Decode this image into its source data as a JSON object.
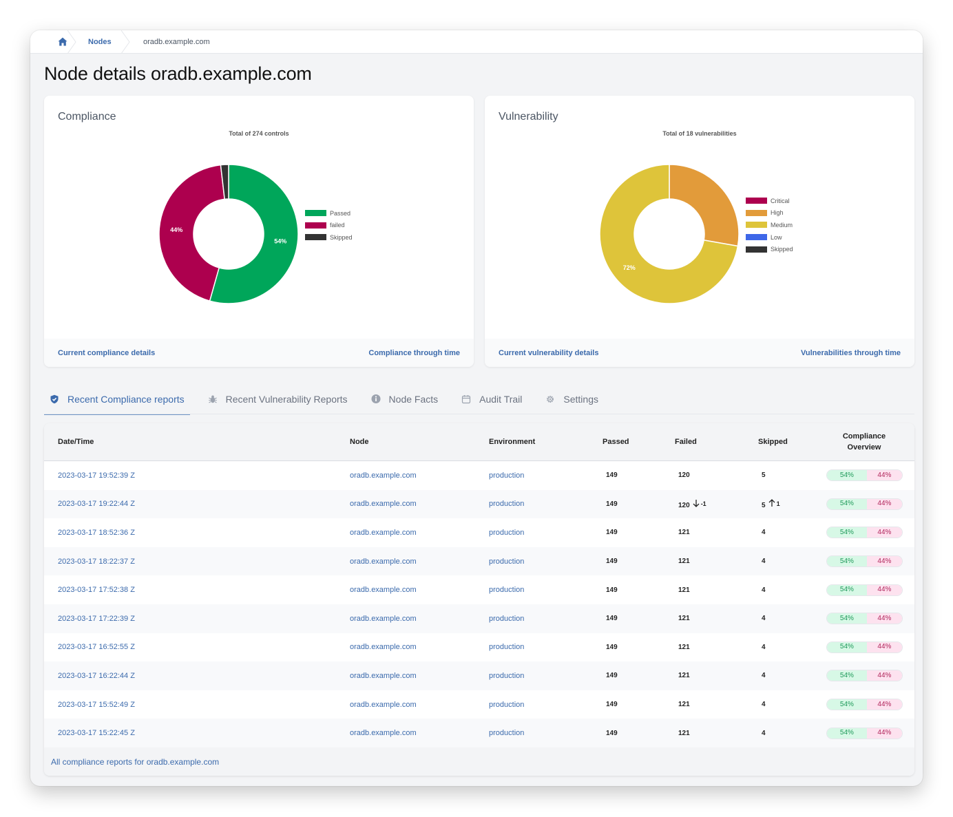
{
  "breadcrumb": {
    "home_icon": "home-icon",
    "items": [
      "Nodes",
      "oradb.example.com"
    ]
  },
  "page": {
    "title": "Node details oradb.example.com"
  },
  "colors": {
    "accent": "#3b6aac",
    "passed": "#00a65a",
    "failed": "#ad004e",
    "skipped": "#333333",
    "critical": "#ad004e",
    "high": "#e29b3a",
    "medium": "#dec43a",
    "low": "#3e67e8"
  },
  "compliance_card": {
    "title": "Compliance",
    "footer_left": "Current compliance details",
    "footer_right": "Compliance through time"
  },
  "vulnerability_card": {
    "title": "Vulnerability",
    "footer_left": "Current vulnerability details",
    "footer_right": "Vulnerabilities through time"
  },
  "chart_data": [
    {
      "type": "pie",
      "variant": "donut",
      "title": "Total of 274 controls",
      "categories": [
        "Passed",
        "failed",
        "Skipped"
      ],
      "values": [
        149,
        120,
        5
      ],
      "colors": [
        "#00a65a",
        "#ad004e",
        "#333333"
      ],
      "data_labels": [
        "54%",
        "44%",
        ""
      ],
      "legend": "right"
    },
    {
      "type": "pie",
      "variant": "donut",
      "title": "Total of 18 vulnerabilities",
      "categories": [
        "Critical",
        "High",
        "Medium",
        "Low",
        "Skipped"
      ],
      "values": [
        0,
        5,
        13,
        0,
        0
      ],
      "colors": [
        "#ad004e",
        "#e29b3a",
        "#dec43a",
        "#3e67e8",
        "#333333"
      ],
      "data_labels": [
        "",
        "",
        "72%",
        "",
        ""
      ],
      "legend": "right"
    }
  ],
  "tabs": [
    {
      "label": "Recent Compliance reports",
      "icon": "shield-check-icon",
      "active": true
    },
    {
      "label": "Recent Vulnerability Reports",
      "icon": "bug-icon",
      "active": false
    },
    {
      "label": "Node Facts",
      "icon": "info-icon",
      "active": false
    },
    {
      "label": "Audit Trail",
      "icon": "calendar-icon",
      "active": false
    },
    {
      "label": "Settings",
      "icon": "gear-icon",
      "active": false
    }
  ],
  "table": {
    "columns": [
      "Date/Time",
      "Node",
      "Environment",
      "Passed",
      "Failed",
      "Skipped",
      "Compliance Overview"
    ],
    "rows": [
      {
        "date": "2023-03-17 19:52:39 Z",
        "node": "oradb.example.com",
        "env": "production",
        "passed": "149",
        "failed": "120",
        "failed_delta": "",
        "skipped": "5",
        "skipped_delta": "",
        "pass_pct": "54%",
        "fail_pct": "44%"
      },
      {
        "date": "2023-03-17 19:22:44 Z",
        "node": "oradb.example.com",
        "env": "production",
        "passed": "149",
        "failed": "120",
        "failed_delta": "-1",
        "skipped": "5",
        "skipped_delta": "1",
        "pass_pct": "54%",
        "fail_pct": "44%"
      },
      {
        "date": "2023-03-17 18:52:36 Z",
        "node": "oradb.example.com",
        "env": "production",
        "passed": "149",
        "failed": "121",
        "failed_delta": "",
        "skipped": "4",
        "skipped_delta": "",
        "pass_pct": "54%",
        "fail_pct": "44%"
      },
      {
        "date": "2023-03-17 18:22:37 Z",
        "node": "oradb.example.com",
        "env": "production",
        "passed": "149",
        "failed": "121",
        "failed_delta": "",
        "skipped": "4",
        "skipped_delta": "",
        "pass_pct": "54%",
        "fail_pct": "44%"
      },
      {
        "date": "2023-03-17 17:52:38 Z",
        "node": "oradb.example.com",
        "env": "production",
        "passed": "149",
        "failed": "121",
        "failed_delta": "",
        "skipped": "4",
        "skipped_delta": "",
        "pass_pct": "54%",
        "fail_pct": "44%"
      },
      {
        "date": "2023-03-17 17:22:39 Z",
        "node": "oradb.example.com",
        "env": "production",
        "passed": "149",
        "failed": "121",
        "failed_delta": "",
        "skipped": "4",
        "skipped_delta": "",
        "pass_pct": "54%",
        "fail_pct": "44%"
      },
      {
        "date": "2023-03-17 16:52:55 Z",
        "node": "oradb.example.com",
        "env": "production",
        "passed": "149",
        "failed": "121",
        "failed_delta": "",
        "skipped": "4",
        "skipped_delta": "",
        "pass_pct": "54%",
        "fail_pct": "44%"
      },
      {
        "date": "2023-03-17 16:22:44 Z",
        "node": "oradb.example.com",
        "env": "production",
        "passed": "149",
        "failed": "121",
        "failed_delta": "",
        "skipped": "4",
        "skipped_delta": "",
        "pass_pct": "54%",
        "fail_pct": "44%"
      },
      {
        "date": "2023-03-17 15:52:49 Z",
        "node": "oradb.example.com",
        "env": "production",
        "passed": "149",
        "failed": "121",
        "failed_delta": "",
        "skipped": "4",
        "skipped_delta": "",
        "pass_pct": "54%",
        "fail_pct": "44%"
      },
      {
        "date": "2023-03-17 15:22:45 Z",
        "node": "oradb.example.com",
        "env": "production",
        "passed": "149",
        "failed": "121",
        "failed_delta": "",
        "skipped": "4",
        "skipped_delta": "",
        "pass_pct": "54%",
        "fail_pct": "44%"
      }
    ],
    "footer_link": "All compliance reports for oradb.example.com"
  }
}
